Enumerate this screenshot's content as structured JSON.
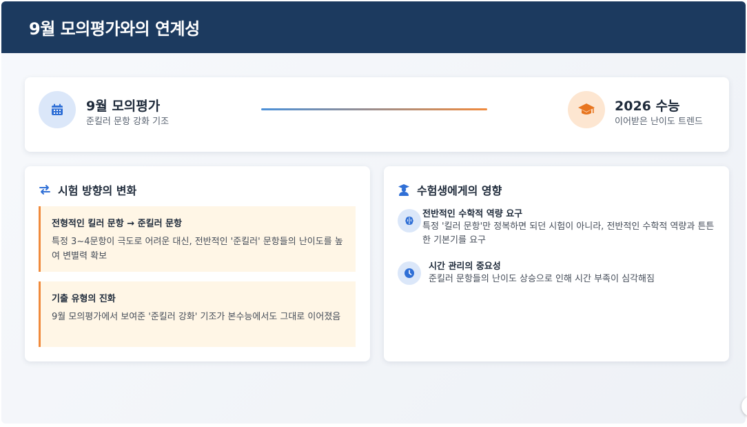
{
  "header": {
    "title": "9월 모의평가와의 연계성"
  },
  "timeline": {
    "start": {
      "title": "9월 모의평가",
      "subtitle": "준킬러 문항 강화 기조",
      "icon": "calendar-icon"
    },
    "end": {
      "title": "2026 수능",
      "subtitle": "이어받은 난이도 트렌드",
      "icon": "graduation-cap-icon"
    }
  },
  "changes": {
    "title": "시험 방향의 변화",
    "icon": "exchange-arrows-icon",
    "items": [
      {
        "title": "전형적인 킬러 문항 → 준킬러 문항",
        "body": "특정 3~4문항이 극도로 어려운 대신, 전반적인 '준킬러' 문항들의 난이도를 높여 변별력 확보"
      },
      {
        "title": "기출 유형의 진화",
        "body": "9월 모의평가에서 보여준 '준킬러 강화' 기조가 본수능에서도 그대로 이어졌음"
      }
    ]
  },
  "impact": {
    "title": "수험생에게의 영향",
    "icon": "student-icon",
    "items": [
      {
        "title": "전반적인 수학적 역량 요구",
        "body": "특정 '킬러 문항'만 정복하면 되던 시험이 아니라, 전반적인 수학적 역량과 튼튼한 기본기를 요구",
        "icon": "brain-icon"
      },
      {
        "title": "시간 관리의 중요성",
        "body": "준킬러 문항들의 난이도 상승으로 인해 시간 부족이 심각해짐",
        "icon": "clock-icon"
      }
    ]
  },
  "colors": {
    "header": "#1c3a5f",
    "accent_blue": "#4a90d9",
    "accent_orange": "#f08a3c"
  }
}
